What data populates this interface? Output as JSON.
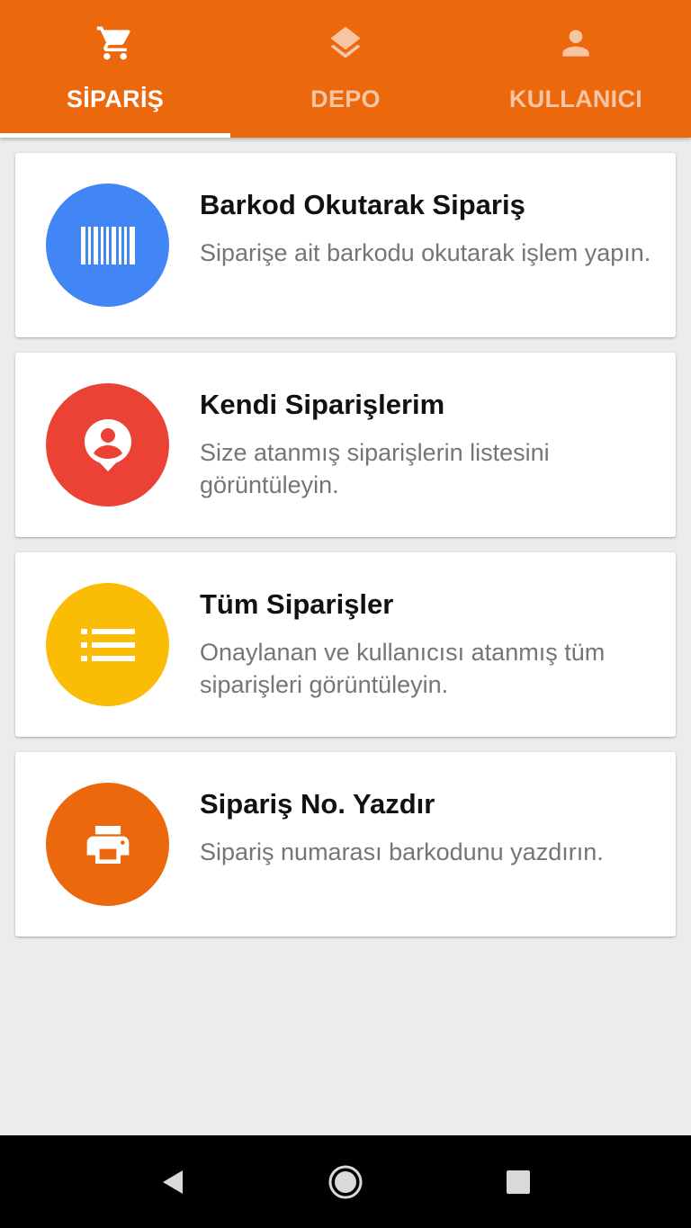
{
  "tabs": [
    {
      "label": "SİPARİŞ",
      "icon": "cart-icon",
      "active": true
    },
    {
      "label": "DEPO",
      "icon": "layers-icon",
      "active": false
    },
    {
      "label": "KULLANICI",
      "icon": "person-icon",
      "active": false
    }
  ],
  "cards": [
    {
      "title": "Barkod Okutarak Sipariş",
      "description": "Siparişe ait barkodu okutarak işlem yapın.",
      "icon": "barcode-icon",
      "color": "#4285f4"
    },
    {
      "title": "Kendi Siparişlerim",
      "description": "Size atanmış siparişlerin listesini görüntüleyin.",
      "icon": "person-pin-icon",
      "color": "#ea4335"
    },
    {
      "title": "Tüm Siparişler",
      "description": "Onaylanan ve kullanıcısı atanmış tüm siparişleri görüntüleyin.",
      "icon": "list-icon",
      "color": "#fbbc05"
    },
    {
      "title": "Sipariş No. Yazdır",
      "description": "Sipariş numarası barkodunu yazdırın.",
      "icon": "printer-icon",
      "color": "#eb680c"
    }
  ],
  "theme": {
    "primary": "#eb680c",
    "background": "#ececec"
  },
  "navbar": {
    "buttons": [
      "back-icon",
      "home-icon",
      "recents-icon"
    ]
  }
}
